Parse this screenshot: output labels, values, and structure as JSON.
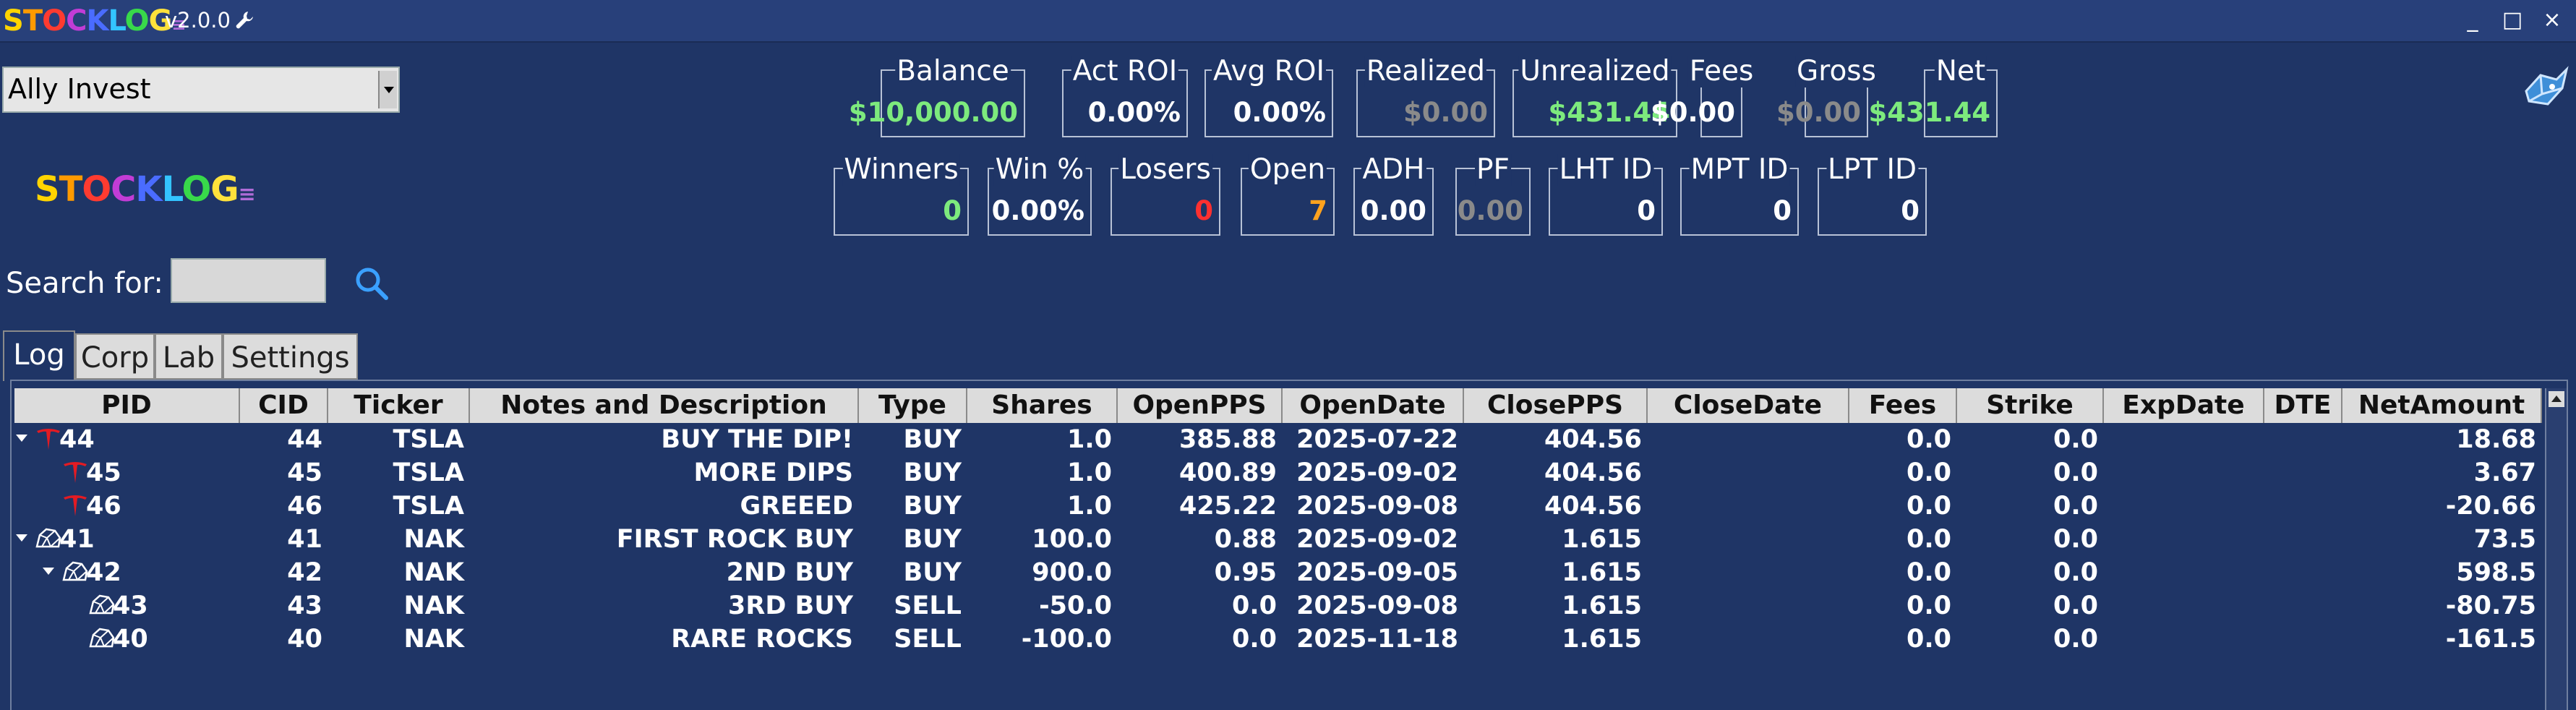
{
  "title_bar": {
    "logo_text": "STOCKLOG",
    "logo_suffix": "≡",
    "version": "v2.0.0",
    "buttons": {
      "minimize": "_",
      "maximize": "□",
      "close": "×"
    }
  },
  "logo_colors": [
    "#ffd400",
    "#ff9a00",
    "#ff3b30",
    "#c23cd6",
    "#4a6cff",
    "#33c4ff",
    "#38d94a",
    "#ffe23b"
  ],
  "broker": {
    "selected": "Ally Invest"
  },
  "side_logo": {
    "text": "STOCKLOG",
    "suffix": "≡"
  },
  "search": {
    "label": "Search for:",
    "value": ""
  },
  "stats_row1": [
    {
      "label": "Balance",
      "value": "$10,000.00",
      "color": "green"
    },
    {
      "label": "Act ROI",
      "value": "0.00%",
      "color": "white"
    },
    {
      "label": "Avg ROI",
      "value": "0.00%",
      "color": "white"
    },
    {
      "label": "Realized",
      "value": "$0.00",
      "color": "gray"
    },
    {
      "label": "Unrealized",
      "value": "$431.44",
      "color": "green"
    },
    {
      "label": "Fees",
      "value": "$0.00",
      "color": "white"
    },
    {
      "label": "Gross",
      "value": "$0.00",
      "color": "gray"
    },
    {
      "label": "Net",
      "value": "$431.44",
      "color": "green"
    }
  ],
  "stats_row2": [
    {
      "label": "Winners",
      "value": "0",
      "color": "green"
    },
    {
      "label": "Win %",
      "value": "0.00%",
      "color": "white"
    },
    {
      "label": "Losers",
      "value": "0",
      "color": "red"
    },
    {
      "label": "Open",
      "value": "7",
      "color": "orange"
    },
    {
      "label": "ADH",
      "value": "0.00",
      "color": "white"
    },
    {
      "label": "PF",
      "value": "0.00",
      "color": "gray"
    },
    {
      "label": "LHT ID",
      "value": "0",
      "color": "white"
    },
    {
      "label": "MPT ID",
      "value": "0",
      "color": "white"
    },
    {
      "label": "LPT ID",
      "value": "0",
      "color": "white"
    }
  ],
  "tabs": [
    "Log",
    "Corp",
    "Lab",
    "Settings"
  ],
  "active_tab": "Log",
  "table": {
    "columns": [
      "PID",
      "CID",
      "Ticker",
      "Notes and Description",
      "Type",
      "Shares",
      "OpenPPS",
      "OpenDate",
      "ClosePPS",
      "CloseDate",
      "Fees",
      "Strike",
      "ExpDate",
      "DTE",
      "NetAmount"
    ],
    "rows": [
      {
        "pid": "44",
        "level": 0,
        "toggle": true,
        "icon": "tesla-icon",
        "cells": [
          "44",
          "TSLA",
          "BUY THE DIP!",
          "BUY",
          "1.0",
          "385.88",
          "2025-07-22",
          "404.56",
          "",
          "0.0",
          "0.0",
          "",
          "",
          "18.68"
        ]
      },
      {
        "pid": "45",
        "level": 1,
        "toggle": false,
        "icon": "tesla-icon",
        "cells": [
          "45",
          "TSLA",
          "MORE DIPS",
          "BUY",
          "1.0",
          "400.89",
          "2025-09-02",
          "404.56",
          "",
          "0.0",
          "0.0",
          "",
          "",
          "3.67"
        ]
      },
      {
        "pid": "46",
        "level": 1,
        "toggle": false,
        "icon": "tesla-icon",
        "cells": [
          "46",
          "TSLA",
          "GREEED",
          "BUY",
          "1.0",
          "425.22",
          "2025-09-08",
          "404.56",
          "",
          "0.0",
          "0.0",
          "",
          "",
          "-20.66"
        ]
      },
      {
        "pid": "41",
        "level": 0,
        "toggle": true,
        "icon": "rock-icon",
        "cells": [
          "41",
          "NAK",
          "FIRST ROCK BUY",
          "BUY",
          "100.0",
          "0.88",
          "2025-09-02",
          "1.615",
          "",
          "0.0",
          "0.0",
          "",
          "",
          "73.5"
        ]
      },
      {
        "pid": "42",
        "level": 1,
        "toggle": true,
        "icon": "rock-icon",
        "cells": [
          "42",
          "NAK",
          "2ND BUY",
          "BUY",
          "900.0",
          "0.95",
          "2025-09-05",
          "1.615",
          "",
          "0.0",
          "0.0",
          "",
          "",
          "598.5"
        ]
      },
      {
        "pid": "43",
        "level": 2,
        "toggle": false,
        "icon": "rock-icon",
        "cells": [
          "43",
          "NAK",
          "3RD BUY",
          "SELL",
          "-50.0",
          "0.0",
          "2025-09-08",
          "1.615",
          "",
          "0.0",
          "0.0",
          "",
          "",
          "-80.75"
        ]
      },
      {
        "pid": "40",
        "level": 2,
        "toggle": false,
        "icon": "rock-icon",
        "cells": [
          "40",
          "NAK",
          "RARE ROCKS",
          "SELL",
          "-100.0",
          "0.0",
          "2025-11-18",
          "1.615",
          "",
          "0.0",
          "0.0",
          "",
          "",
          "-161.5"
        ]
      }
    ]
  }
}
